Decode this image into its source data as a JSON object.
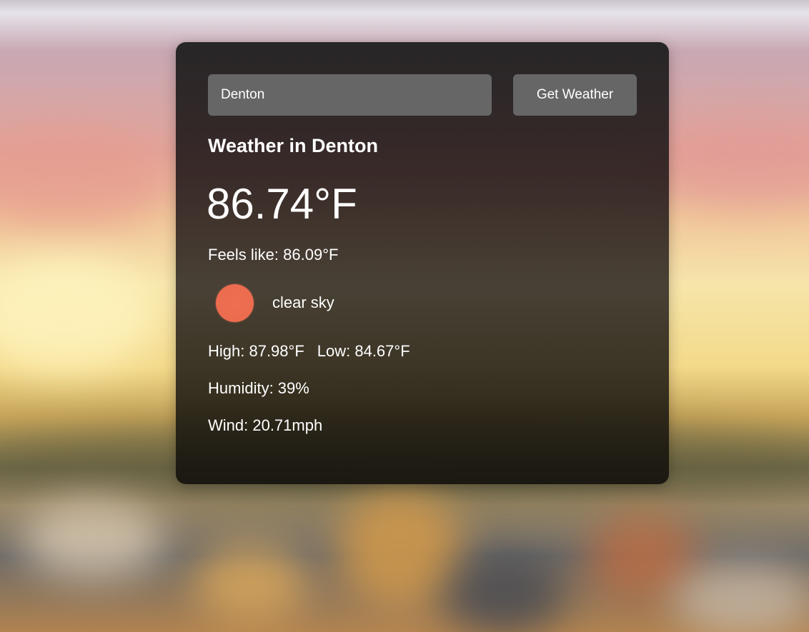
{
  "search": {
    "value": "Denton",
    "button_label": "Get Weather"
  },
  "weather": {
    "title": "Weather in Denton",
    "temperature": "86.74°F",
    "feels_like": "Feels like: 86.09°F",
    "condition_icon": "sun-icon",
    "condition_icon_color": "#ec6c4f",
    "condition": "clear sky",
    "high": "High: 87.98°F",
    "low": "Low: 84.67°F",
    "humidity": "Humidity: 39%",
    "wind": "Wind: 20.71mph"
  }
}
